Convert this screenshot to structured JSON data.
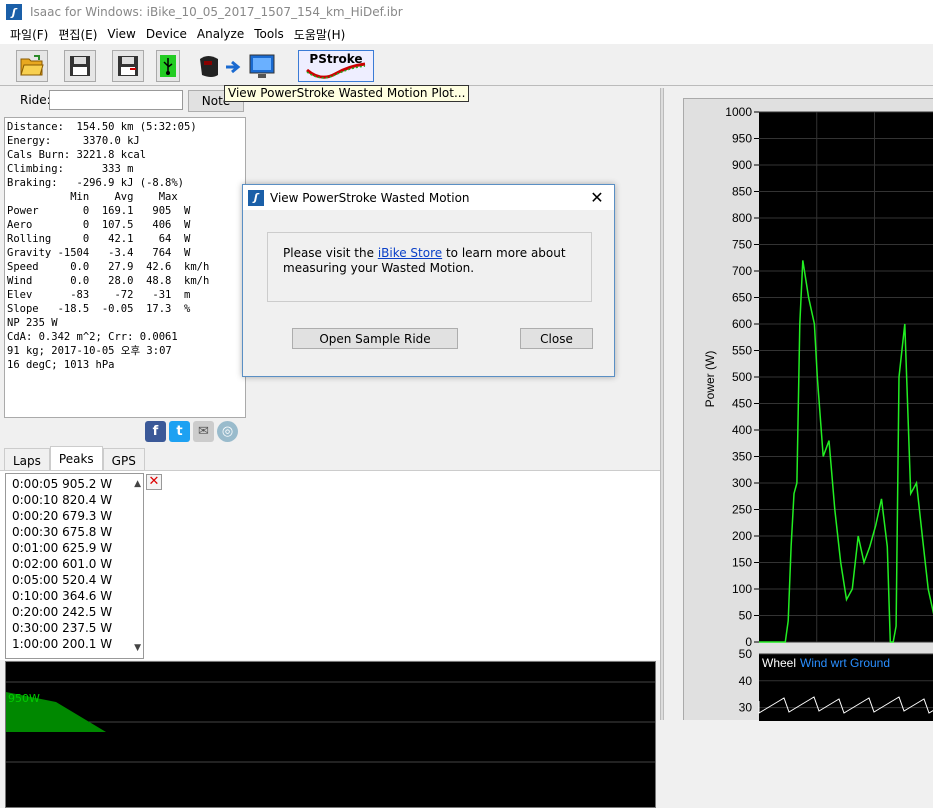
{
  "window": {
    "title": "Isaac for Windows:  iBike_10_05_2017_1507_154_km_HiDef.ibr"
  },
  "menu": [
    "파일(F)",
    "편집(E)",
    "View",
    "Device",
    "Analyze",
    "Tools",
    "도움말(H)"
  ],
  "toolbar": {
    "pstroke_label": "PStroke",
    "tooltip": "View PowerStroke Wasted Motion Plot..."
  },
  "ride": {
    "label": "Ride:",
    "value": "",
    "note_label": "Note"
  },
  "stats_lines": [
    "Distance:  154.50 km (5:32:05)",
    "Energy:     3370.0 kJ",
    "Cals Burn: 3221.8 kcal",
    "Climbing:      333 m",
    "Braking:   -296.9 kJ (-8.8%)",
    "          Min    Avg    Max",
    "Power       0  169.1   905  W",
    "Aero        0  107.5   406  W",
    "Rolling     0   42.1    64  W",
    "Gravity -1504   -3.4   764  W",
    "Speed     0.0   27.9  42.6  km/h",
    "Wind      0.0   28.0  48.8  km/h",
    "Elev      -83    -72   -31  m",
    "Slope   -18.5  -0.05  17.3  %",
    "NP 235 W",
    "CdA: 0.342 m^2; Crr: 0.0061",
    "91 kg; 2017-10-05 오후 3:07",
    "16 degC; 1013 hPa"
  ],
  "tabs": [
    "Laps",
    "Peaks",
    "GPS"
  ],
  "peaks": [
    "0:00:05 905.2 W",
    "0:00:10 820.4 W",
    "0:00:20 679.3 W",
    "0:00:30 675.8 W",
    "0:01:00 625.9 W",
    "0:02:00 601.0 W",
    "0:05:00 520.4 W",
    "0:10:00 364.6 W",
    "0:20:00 242.5 W",
    "0:30:00 237.5 W",
    "1:00:00 200.1 W"
  ],
  "bottom_chart": {
    "label": "950W",
    "color": "#00cc00"
  },
  "dialog": {
    "title": "View PowerStroke Wasted Motion",
    "text_before": "Please visit the ",
    "link": "iBike Store",
    "text_after": " to learn more about",
    "line2": "measuring your Wasted Motion.",
    "open_sample": "Open Sample Ride",
    "close": "Close"
  },
  "chart_data": [
    {
      "type": "line",
      "ylabel": "Power (W)",
      "ylim": [
        0,
        1000
      ],
      "yticks": [
        "1000",
        "950",
        "900",
        "850",
        "800",
        "750",
        "700",
        "650",
        "600",
        "550",
        "500",
        "450",
        "400",
        "350",
        "300",
        "250",
        "200",
        "150",
        "100",
        "50",
        "0"
      ],
      "series_color": "#22ee22",
      "x": [
        0,
        3,
        5,
        7,
        9,
        10,
        11,
        12,
        13,
        14,
        15,
        17,
        19,
        20,
        22,
        24,
        26,
        28,
        30,
        32,
        34,
        36,
        38,
        40,
        42,
        44,
        45,
        46,
        47,
        48,
        50,
        52,
        54,
        56,
        58,
        60
      ],
      "values": [
        0,
        0,
        0,
        0,
        0,
        40,
        180,
        280,
        300,
        600,
        720,
        650,
        600,
        500,
        350,
        380,
        250,
        150,
        80,
        100,
        200,
        150,
        180,
        220,
        270,
        180,
        0,
        0,
        30,
        500,
        600,
        280,
        300,
        200,
        100,
        50
      ]
    },
    {
      "type": "line",
      "legend": [
        "Wheel",
        "Wind wrt Ground"
      ],
      "legend_colors": [
        "#ffffff",
        "#2a8fff"
      ],
      "yticks": [
        "50",
        "40",
        "30"
      ],
      "ylim": [
        25,
        50
      ]
    }
  ]
}
